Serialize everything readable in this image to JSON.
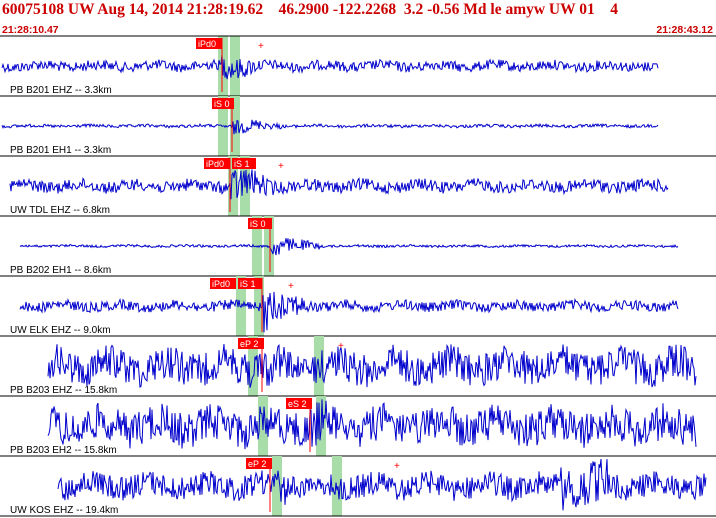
{
  "header": {
    "title": "60075108 UW Aug 14, 2014 21:28:19.62    46.2900 -122.2268  3.2 -0.56 Md le amyw UW 01    4",
    "time_start": "21:28:10.47",
    "time_end": "21:28:43.12"
  },
  "colors": {
    "trace": "#0000cc",
    "pick": "#ff0000",
    "band": "#a8dca8",
    "header_text": "#cc0000",
    "divider": "#000000"
  },
  "traces": [
    {
      "label": "PB B201 EHZ -- 3.3km",
      "amp": 5,
      "sec_amp": 5,
      "event_amp": 14,
      "picks": [
        {
          "text": "iPd0",
          "type": "P"
        },
        {
          "text": "+",
          "type": "mark"
        }
      ]
    },
    {
      "label": "PB B201 EH1 -- 3.3km",
      "amp": 1.5,
      "sec_amp": 1.5,
      "event_amp": 8,
      "picks": [
        {
          "text": "iS 0",
          "type": "S"
        }
      ]
    },
    {
      "label": "UW TDL EHZ -- 6.8km",
      "amp": 6,
      "sec_amp": 6,
      "event_amp": 20,
      "picks": [
        {
          "text": "iPd0",
          "type": "P"
        },
        {
          "text": "iS 1",
          "type": "S"
        },
        {
          "text": "+",
          "type": "mark"
        }
      ]
    },
    {
      "label": "PB B202 EH1 -- 8.6km",
      "amp": 1.2,
      "sec_amp": 1.2,
      "event_amp": 10,
      "picks": [
        {
          "text": "iS 0",
          "type": "S"
        }
      ]
    },
    {
      "label": "UW ELK EHZ -- 9.0km",
      "amp": 5,
      "sec_amp": 5,
      "event_amp": 22,
      "picks": [
        {
          "text": "iPd0",
          "type": "P"
        },
        {
          "text": "iS 1",
          "type": "S"
        },
        {
          "text": "+",
          "type": "mark"
        }
      ]
    },
    {
      "label": "PB B203 EHZ -- 15.8km",
      "amp": 17,
      "sec_amp": 17,
      "event_amp": 26,
      "picks": [
        {
          "text": "eP 2",
          "type": "P"
        },
        {
          "text": "+",
          "type": "mark"
        }
      ]
    },
    {
      "label": "PB B203 EH2 -- 15.8km",
      "amp": 18,
      "sec_amp": 18,
      "event_amp": 26,
      "picks": [
        {
          "text": "eS 2",
          "type": "S"
        }
      ]
    },
    {
      "label": "UW KOS EHZ -- 19.4km",
      "amp": 12,
      "sec_amp": 22,
      "event_amp": 20,
      "picks": [
        {
          "text": "eP 2",
          "type": "P"
        },
        {
          "text": "+",
          "type": "mark"
        }
      ]
    }
  ]
}
